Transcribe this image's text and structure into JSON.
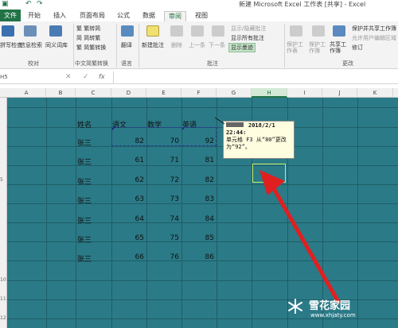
{
  "window": {
    "title": "新建 Microsoft Excel 工作表 [共享] - Excel"
  },
  "tabs": [
    "文件",
    "开始",
    "插入",
    "页面布局",
    "公式",
    "数据",
    "审阅",
    "视图"
  ],
  "active_tab": "审阅",
  "ribbon": {
    "proofing": {
      "spell": "拼写检查",
      "research": "信息检索",
      "thesaurus": "同义词库",
      "group": "校对"
    },
    "chinese": {
      "t2s": "繁转简",
      "s2t": "简转繁",
      "convert": "简繁转换",
      "group": "中文简繁转换"
    },
    "language": {
      "translate": "翻译",
      "group": "语言"
    },
    "comments": {
      "new": "新建批注",
      "delete": "删除",
      "prev": "上一条",
      "next": "下一条",
      "show_hide": "显示/隐藏批注",
      "show_all": "显示所有批注",
      "show_ink": "显示墨迹",
      "group": "批注"
    },
    "changes": {
      "protect_sheet": "保护工作表",
      "protect_workbook": "保护工作簿",
      "share": "共享工作簿",
      "protect_share": "保护并共享工作簿",
      "allow_edit": "允许用户编辑区域",
      "track": "修订",
      "group": "更改"
    }
  },
  "formula_bar": {
    "name_box": "H5",
    "fx": "fx",
    "value": ""
  },
  "columns": [
    "A",
    "B",
    "C",
    "D",
    "E",
    "F",
    "G",
    "H",
    "I",
    "J",
    "K"
  ],
  "selected_column": "H",
  "rows": [
    "1",
    "2",
    "3",
    "4",
    "5",
    "6",
    "7",
    "8",
    "9",
    "10",
    "11",
    "12",
    "13"
  ],
  "table": {
    "headers": [
      "姓名",
      "语文",
      "数学",
      "英语"
    ],
    "rows": [
      [
        "张三",
        "82",
        "70",
        "92"
      ],
      [
        "张三",
        "61",
        "71",
        "81"
      ],
      [
        "张三",
        "62",
        "72",
        "82"
      ],
      [
        "张三",
        "63",
        "73",
        "83"
      ],
      [
        "张三",
        "64",
        "74",
        "84"
      ],
      [
        "张三",
        "65",
        "75",
        "85"
      ],
      [
        "张三",
        "66",
        "76",
        "86"
      ]
    ]
  },
  "comment": {
    "header": "2018/2/1",
    "time": "22:44:",
    "body": "单元格 F3 从“80”更改为“92”。"
  },
  "watermark": {
    "name": "雪花家园",
    "url": "www.xhjaty.com"
  },
  "colors": {
    "excel_green": "#217346",
    "sheet_fill": "#2b7a87",
    "arrow": "#e02020"
  }
}
